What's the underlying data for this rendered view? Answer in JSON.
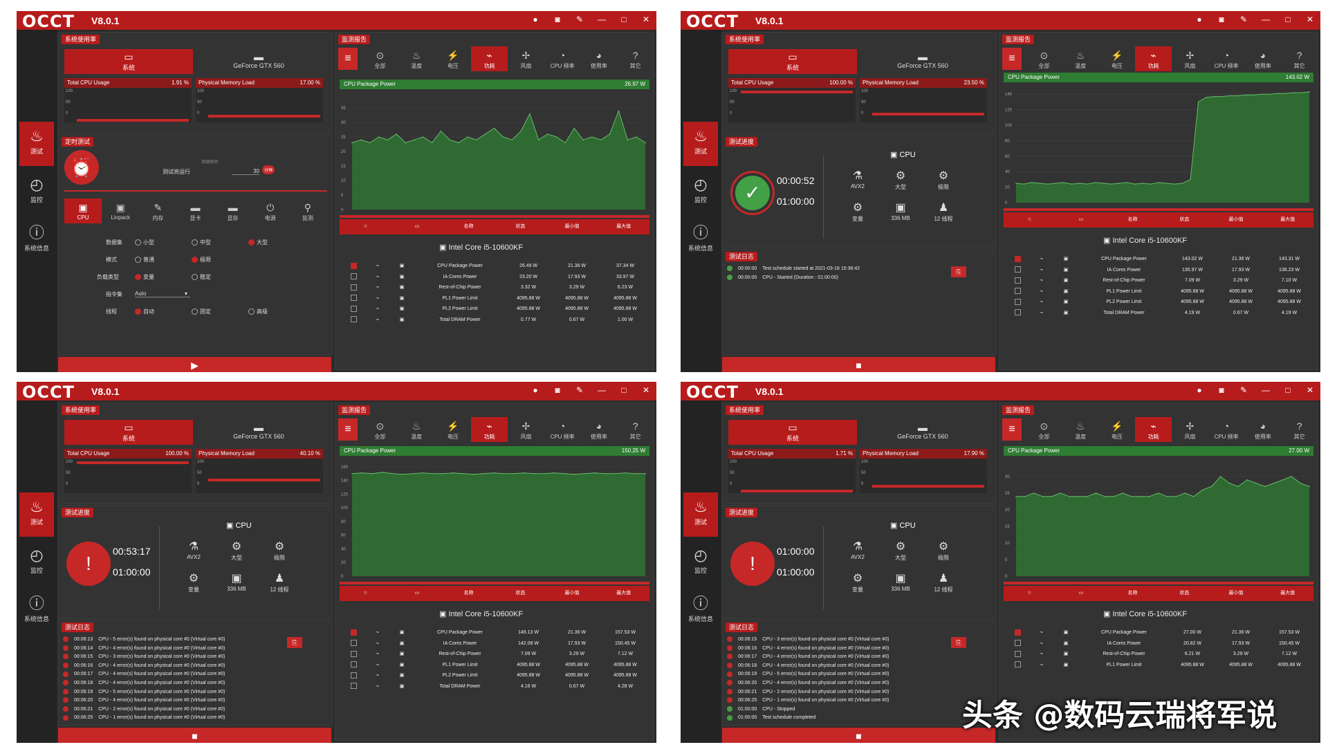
{
  "app": {
    "logo": "OCCT",
    "version": "V8.0.1",
    "window_buttons": [
      "●",
      "◙",
      "✎",
      "—",
      "□",
      "✕"
    ]
  },
  "sidebar": [
    {
      "label": "测试",
      "icon": "flame-icon",
      "glyph": "♨"
    },
    {
      "label": "监控",
      "icon": "gauge-icon",
      "glyph": "◴"
    },
    {
      "label": "系统信息",
      "icon": "info-icon",
      "glyph": "ⓘ"
    }
  ],
  "panels": {
    "usage": "系统使用率",
    "schedule": "定时测试",
    "progress": "测试进度",
    "log": "测试日志",
    "monitor": "监测报告"
  },
  "sys_tabs": [
    "系统",
    "GeForce GTX 560"
  ],
  "mini_labels": {
    "cpu": "Total CPU Usage",
    "mem": "Physical Memory Load"
  },
  "mini_axis": [
    "100",
    "50",
    "0"
  ],
  "monitor_tabs": [
    {
      "label": "全部",
      "glyph": "⊙"
    },
    {
      "label": "温度",
      "glyph": "♨"
    },
    {
      "label": "电压",
      "glyph": "⚡"
    },
    {
      "label": "功耗",
      "glyph": "⌁"
    },
    {
      "label": "风扇",
      "glyph": "✢"
    },
    {
      "label": "CPU 频率",
      "glyph": "◔"
    },
    {
      "label": "使用率",
      "glyph": "◕"
    },
    {
      "label": "其它",
      "glyph": "?"
    }
  ],
  "table_head": [
    "☆",
    "▭",
    "名称",
    "状态",
    "最小值",
    "最大值"
  ],
  "device": "Intel Core i5-10600KF",
  "cpu_label": "CPU",
  "features": [
    {
      "label": "AVX2",
      "glyph": "⚗"
    },
    {
      "label": "大型",
      "glyph": "⚙"
    },
    {
      "label": "极限",
      "glyph": "⚙"
    },
    {
      "label": "变量",
      "glyph": "⚙"
    },
    {
      "label": "336 MB",
      "glyph": "▣"
    },
    {
      "label": "12 线程",
      "glyph": "♟"
    }
  ],
  "chart_title": "CPU Package Power",
  "test_tabs": [
    "CPU",
    "Linpack",
    "内存",
    "显卡",
    "显存",
    "电源",
    "监测"
  ],
  "config": {
    "rows": [
      {
        "label": "数据集",
        "opts": [
          "小型",
          "中型",
          "大型"
        ],
        "sel": 2
      },
      {
        "label": "模式",
        "opts": [
          "普通",
          "极限"
        ],
        "sel": 1
      },
      {
        "label": "负载类型",
        "opts": [
          "变量",
          "稳定"
        ],
        "sel": 0
      },
      {
        "label": "指令集",
        "value": "Auto"
      },
      {
        "label": "线程",
        "opts": [
          "自动",
          "固定",
          "高级"
        ],
        "sel": 0
      }
    ],
    "duration_label": "测试将运行",
    "duration_hint": "持续时间",
    "duration_value": "30",
    "duration_unit": "分钟"
  },
  "screens": [
    {
      "cpu_pct": "1.91 %",
      "mem_pct": "17.00 %",
      "cpu_fill": 0.02,
      "mem_fill": 0.17,
      "power": "26.97 W",
      "chart_data": {
        "type": "line",
        "title": "CPU Package Power",
        "ylim": [
          0,
          40
        ],
        "yticks": [
          0,
          5,
          10,
          15,
          20,
          25,
          30,
          35
        ],
        "values": [
          23,
          24,
          23,
          25,
          24,
          26,
          23,
          24,
          25,
          23,
          27,
          24,
          23,
          25,
          24,
          26,
          28,
          25,
          24,
          27,
          33,
          24,
          26,
          25,
          23,
          28,
          24,
          25,
          24,
          26,
          34,
          24,
          25,
          23
        ]
      },
      "rows": [
        {
          "name": "CPU Package Power",
          "status": "26.49 W",
          "min": "21.36 W",
          "max": "37.34 W"
        },
        {
          "name": "IA Cores Power",
          "status": "23.20 W",
          "min": "17.93 W",
          "max": "33.97 W"
        },
        {
          "name": "Rest-of-Chip Power",
          "status": "3.32 W",
          "min": "3.29 W",
          "max": "6.23 W"
        },
        {
          "name": "PL1 Power Limit",
          "status": "4095.88 W",
          "min": "4095.88 W",
          "max": "4095.88 W"
        },
        {
          "name": "PL2 Power Limit",
          "status": "4095.88 W",
          "min": "4095.88 W",
          "max": "4095.88 W"
        },
        {
          "name": "Total DRAM Power",
          "status": "0.77 W",
          "min": "0.67 W",
          "max": "1.00 W"
        }
      ]
    },
    {
      "cpu_pct": "100.00 %",
      "mem_pct": "23.50 %",
      "cpu_fill": 1.0,
      "mem_fill": 0.24,
      "power": "143.02 W",
      "elapsed": "00:00:52",
      "total": "01:00:00",
      "chart_data": {
        "type": "line",
        "title": "CPU Package Power",
        "ylim": [
          0,
          150
        ],
        "yticks": [
          0,
          20,
          40,
          60,
          80,
          100,
          120,
          140
        ],
        "values": [
          25,
          24,
          26,
          25,
          24,
          25,
          26,
          24,
          25,
          24,
          26,
          25,
          24,
          25,
          26,
          24,
          25,
          24,
          26,
          25,
          24,
          25,
          30,
          130,
          136,
          137,
          137,
          138,
          138,
          139,
          139,
          140,
          140,
          141,
          141,
          142,
          142,
          143
        ]
      },
      "rows": [
        {
          "name": "CPU Package Power",
          "status": "143.02 W",
          "min": "21.36 W",
          "max": "143.31 W"
        },
        {
          "name": "IA Cores Power",
          "status": "135.97 W",
          "min": "17.93 W",
          "max": "136.23 W"
        },
        {
          "name": "Rest-of-Chip Power",
          "status": "7.09 W",
          "min": "3.29 W",
          "max": "7.10 W"
        },
        {
          "name": "PL1 Power Limit",
          "status": "4095.88 W",
          "min": "4095.88 W",
          "max": "4095.88 W"
        },
        {
          "name": "PL2 Power Limit",
          "status": "4095.88 W",
          "min": "4095.88 W",
          "max": "4095.88 W"
        },
        {
          "name": "Total DRAM Power",
          "status": "4.19 W",
          "min": "0.67 W",
          "max": "4.19 W"
        }
      ],
      "log": [
        {
          "t": "00:00:00",
          "m": "Test schedule started at 2021-03-18 15:36:42",
          "s": "ok"
        },
        {
          "t": "00:00:00",
          "m": "CPU - Started (Duration : 01:00:00)",
          "s": "ok"
        }
      ]
    },
    {
      "cpu_pct": "100.00 %",
      "mem_pct": "40.10 %",
      "cpu_fill": 1.0,
      "mem_fill": 0.4,
      "power": "150.25 W",
      "elapsed": "00:53:17",
      "total": "01:00:00",
      "chart_data": {
        "type": "line",
        "title": "CPU Package Power",
        "ylim": [
          0,
          170
        ],
        "yticks": [
          0,
          20,
          40,
          60,
          80,
          100,
          120,
          140,
          160
        ],
        "values": [
          150,
          151,
          150,
          152,
          150,
          149,
          150,
          151,
          150,
          150,
          151,
          150,
          149,
          150,
          151,
          150,
          150,
          151,
          150,
          150,
          151,
          150,
          149,
          150,
          151,
          150,
          150,
          151,
          150,
          150
        ]
      },
      "rows": [
        {
          "name": "CPU Package Power",
          "status": "149.13 W",
          "min": "21.36 W",
          "max": "157.53 W"
        },
        {
          "name": "IA Cores Power",
          "status": "142.08 W",
          "min": "17.93 W",
          "max": "150.45 W"
        },
        {
          "name": "Rest-of-Chip Power",
          "status": "7.09 W",
          "min": "3.29 W",
          "max": "7.12 W"
        },
        {
          "name": "PL1 Power Limit",
          "status": "4095.88 W",
          "min": "4095.88 W",
          "max": "4095.88 W"
        },
        {
          "name": "PL2 Power Limit",
          "status": "4095.88 W",
          "min": "4095.88 W",
          "max": "4095.88 W"
        },
        {
          "name": "Total DRAM Power",
          "status": "4.16 W",
          "min": "0.67 W",
          "max": "4.28 W"
        }
      ],
      "log": [
        {
          "t": "00:06:13",
          "m": "CPU - 5 error(s) found on physical core #0 (Virtual core #0)",
          "s": "err"
        },
        {
          "t": "00:06:14",
          "m": "CPU - 4 error(s) found on physical core #0 (Virtual core #0)",
          "s": "err"
        },
        {
          "t": "00:06:15",
          "m": "CPU - 3 error(s) found on physical core #0 (Virtual core #0)",
          "s": "err"
        },
        {
          "t": "00:06:16",
          "m": "CPU - 4 error(s) found on physical core #0 (Virtual core #0)",
          "s": "err"
        },
        {
          "t": "00:06:17",
          "m": "CPU - 4 error(s) found on physical core #0 (Virtual core #0)",
          "s": "err"
        },
        {
          "t": "00:06:18",
          "m": "CPU - 4 error(s) found on physical core #0 (Virtual core #0)",
          "s": "err"
        },
        {
          "t": "00:06:19",
          "m": "CPU - 5 error(s) found on physical core #0 (Virtual core #0)",
          "s": "err"
        },
        {
          "t": "00:06:20",
          "m": "CPU - 4 error(s) found on physical core #0 (Virtual core #0)",
          "s": "err"
        },
        {
          "t": "00:06:21",
          "m": "CPU - 2 error(s) found on physical core #0 (Virtual core #0)",
          "s": "err"
        },
        {
          "t": "00:06:25",
          "m": "CPU - 1 error(s) found on physical core #0 (Virtual core #0)",
          "s": "err"
        }
      ]
    },
    {
      "cpu_pct": "1.71 %",
      "mem_pct": "17.90 %",
      "cpu_fill": 0.02,
      "mem_fill": 0.18,
      "power": "27.00 W",
      "elapsed": "01:00:00",
      "total": "01:00:00",
      "chart_data": {
        "type": "line",
        "title": "CPU Package Power",
        "ylim": [
          0,
          35
        ],
        "yticks": [
          0,
          5,
          10,
          15,
          20,
          25,
          30
        ],
        "values": [
          24,
          24,
          25,
          24,
          24,
          25,
          24,
          24,
          24,
          25,
          24,
          24,
          25,
          24,
          24,
          24,
          25,
          24,
          24,
          25,
          24,
          26,
          27,
          30,
          28,
          27,
          29,
          28,
          27,
          28,
          29,
          30,
          28,
          27
        ]
      },
      "rows": [
        {
          "name": "CPU Package Power",
          "status": "27.00 W",
          "min": "21.36 W",
          "max": "157.53 W"
        },
        {
          "name": "IA Cores Power",
          "status": "20.82 W",
          "min": "17.93 W",
          "max": "150.45 W"
        },
        {
          "name": "Rest-of-Chip Power",
          "status": "6.21 W",
          "min": "3.29 W",
          "max": "7.12 W"
        },
        {
          "name": "PL1 Power Limit",
          "status": "4095.88 W",
          "min": "4095.88 W",
          "max": "4095.88 W"
        }
      ],
      "log": [
        {
          "t": "00:06:15",
          "m": "CPU - 3 error(s) found on physical core #0 (Virtual core #0)",
          "s": "err"
        },
        {
          "t": "00:06:16",
          "m": "CPU - 4 error(s) found on physical core #0 (Virtual core #0)",
          "s": "err"
        },
        {
          "t": "00:06:17",
          "m": "CPU - 4 error(s) found on physical core #0 (Virtual core #0)",
          "s": "err"
        },
        {
          "t": "00:06:18",
          "m": "CPU - 4 error(s) found on physical core #0 (Virtual core #0)",
          "s": "err"
        },
        {
          "t": "00:06:19",
          "m": "CPU - 5 error(s) found on physical core #0 (Virtual core #0)",
          "s": "err"
        },
        {
          "t": "00:06:20",
          "m": "CPU - 4 error(s) found on physical core #0 (Virtual core #0)",
          "s": "err"
        },
        {
          "t": "00:06:21",
          "m": "CPU - 2 error(s) found on physical core #0 (Virtual core #0)",
          "s": "err"
        },
        {
          "t": "00:06:25",
          "m": "CPU - 1 error(s) found on physical core #0 (Virtual core #0)",
          "s": "err"
        },
        {
          "t": "01:00:00",
          "m": "CPU - Stopped",
          "s": "ok"
        },
        {
          "t": "01:00:00",
          "m": "Test schedule completed",
          "s": "ok"
        }
      ]
    }
  ],
  "watermark": "头条 @数码云瑞将军说",
  "colors": {
    "accent": "#c62828",
    "ok": "#43a047",
    "chart_fill": "#2e7d32"
  }
}
